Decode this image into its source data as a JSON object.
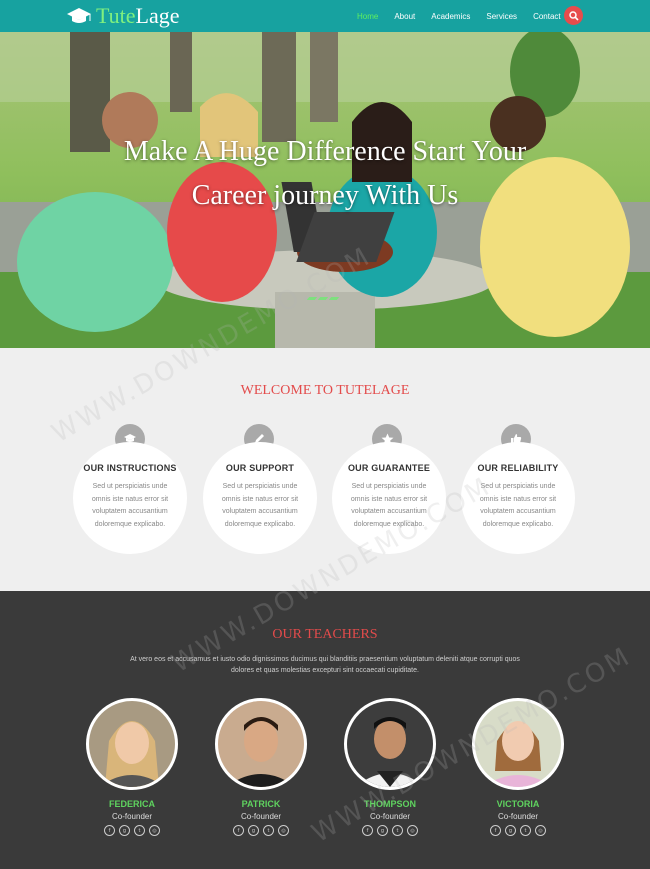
{
  "header": {
    "logo_part1": "Tute",
    "logo_part2": "Lage",
    "logo_icon": "graduation-cap-icon",
    "nav": [
      "Home",
      "About",
      "Academics",
      "Services",
      "Contact"
    ],
    "active_nav": "Home",
    "search_icon": "search-icon"
  },
  "hero": {
    "title_line1": "Make A Huge Difference Start Your",
    "title_line2": "Career journey With Us"
  },
  "welcome": {
    "title": "WELCOME TO TUTELAGE",
    "features": [
      {
        "icon": "graduation-cap-icon",
        "title": "OUR INSTRUCTIONS",
        "text": "Sed ut perspiciatis unde omnis iste natus error sit voluptatem accusantium doloremque explicabo."
      },
      {
        "icon": "pencil-icon",
        "title": "OUR SUPPORT",
        "text": "Sed ut perspiciatis unde omnis iste natus error sit voluptatem accusantium doloremque explicabo."
      },
      {
        "icon": "star-icon",
        "title": "OUR GUARANTEE",
        "text": "Sed ut perspiciatis unde omnis iste natus error sit voluptatem accusantium doloremque explicabo."
      },
      {
        "icon": "thumbs-up-icon",
        "title": "OUR RELIABILITY",
        "text": "Sed ut perspiciatis unde omnis iste natus error sit voluptatem accusantium doloremque explicabo."
      }
    ]
  },
  "teachers": {
    "title": "OUR TEACHERS",
    "description": "At vero eos et accusamus et iusto odio dignissimos ducimus qui blanditiis praesentium voluptatum deleniti atque corrupti quos dolores et quas molestias excepturi sint occaecati cupiditate.",
    "list": [
      {
        "name": "FEDERICA",
        "role": "Co-founder"
      },
      {
        "name": "PATRICK",
        "role": "Co-founder"
      },
      {
        "name": "THOMPSON",
        "role": "Co-founder"
      },
      {
        "name": "VICTORIA",
        "role": "Co-founder"
      }
    ],
    "social_icons": [
      "f",
      "g",
      "t",
      "◎"
    ]
  },
  "watermark": "WWW.DOWNDEMO.COM",
  "colors": {
    "header": "#17a2a0",
    "accent_red": "#e34b4b",
    "accent_green": "#5fd35f",
    "dark_section": "#3a3a3a",
    "light_section": "#efefef"
  }
}
